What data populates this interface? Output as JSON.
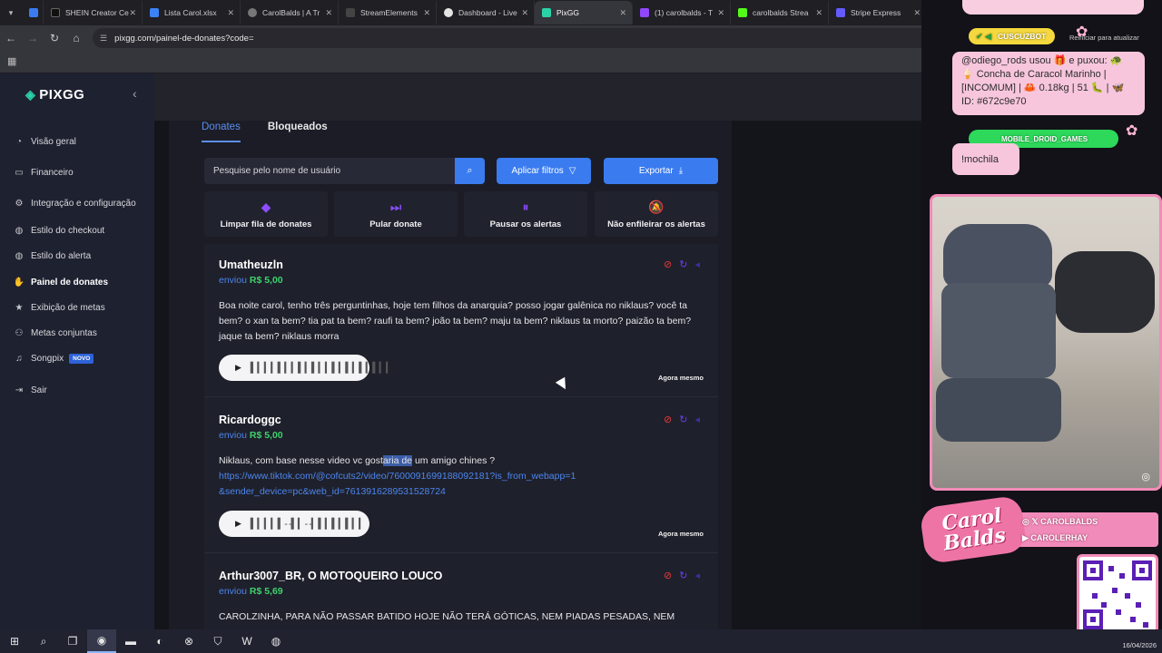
{
  "browser": {
    "tabs": [
      {
        "label": "SHEIN Creator Ce",
        "color": "#111111"
      },
      {
        "label": "Lista Carol.xlsx",
        "color": "#3b82f6"
      },
      {
        "label": "CarolBalds | A Tr",
        "color": "#555555"
      },
      {
        "label": "StreamElements",
        "color": "#222222"
      },
      {
        "label": "Dashboard - Live",
        "color": "#e5e5e5"
      },
      {
        "label": "PixGG",
        "color": "#2bd3a8"
      },
      {
        "label": "(1) carolbalds - T",
        "color": "#9146ff"
      },
      {
        "label": "carolbalds Strea",
        "color": "#53fc18"
      },
      {
        "label": "Stripe Express",
        "color": "#635bff"
      }
    ],
    "url": "pixgg.com/painel-de-donates?code=",
    "refresh_hint": "Reiniciar para atualizar"
  },
  "sidebar": {
    "logo": "PIXGG",
    "items": [
      {
        "label": "Visão geral",
        "icon": "speedometer-icon"
      },
      {
        "label": "Financeiro",
        "icon": "wallet-icon"
      },
      {
        "label": "Integração e configuração",
        "icon": "gear-icon"
      },
      {
        "label": "Estilo do checkout",
        "icon": "palette-icon"
      },
      {
        "label": "Estilo do alerta",
        "icon": "palette-icon"
      },
      {
        "label": "Painel de donates",
        "icon": "hand-heart-icon"
      },
      {
        "label": "Exibição de metas",
        "icon": "star-icon"
      },
      {
        "label": "Metas conjuntas",
        "icon": "users-icon"
      },
      {
        "label": "Songpix",
        "icon": "music-icon",
        "badge": "NOVO"
      },
      {
        "label": "Sair",
        "icon": "logout-icon"
      }
    ]
  },
  "main": {
    "tabs": [
      {
        "label": "Donates"
      },
      {
        "label": "Bloqueados"
      }
    ],
    "search_placeholder": "Pesquise pelo nome de usuário",
    "filter_label": "Aplicar filtros",
    "export_label": "Exportar",
    "actions": [
      {
        "label": "Limpar fila de donates",
        "icon": "eraser-icon"
      },
      {
        "label": "Pular donate",
        "icon": "skip-icon"
      },
      {
        "label": "Pausar os alertas",
        "icon": "pause-icon"
      },
      {
        "label": "Não enfileirar os alertas",
        "icon": "bell-off-icon"
      }
    ],
    "donations": [
      {
        "name": "Umatheuzln",
        "sent": "enviou",
        "amount": "R$ 5,00",
        "message": "Boa noite carol, tenho três perguntinhas, hoje tem filhos da anarquia? posso jogar galênica no niklaus? você ta bem? o xan ta bem? tia pat ta bem? raufi ta bem? joão ta bem? maju ta bem? niklaus ta morto? paizão ta bem? jaque ta bem? niklaus morra",
        "time": "Agora mesmo"
      },
      {
        "name": "Ricardoggc",
        "sent": "enviou",
        "amount": "R$ 5,00",
        "message_before": "Niklaus, com base nesse video vc gost",
        "message_highlight": "aria de",
        "message_after": " um amigo chines ?",
        "link": "https://www.tiktok.com/@cofcuts2/video/7600091699188092181?is_from_webapp=1&sender_device=pc&web_id=7613916289531528724",
        "time": "Agora mesmo"
      },
      {
        "name": "Arthur3007_BR, O MOTOQUEIRO LOUCO",
        "sent": "enviou",
        "amount": "R$ 5,69",
        "message": "CAROLZINHA, PARA NÃO PASSAR BATIDO HOJE NÃO TERÁ GÓTICAS, NEM PIADAS PESADAS, NEM"
      }
    ]
  },
  "overlay": {
    "chat1_user": "CUSCUZBOT",
    "chat1_text": "@odiego_rods usou 🎁 e puxou: 🐢 🍦 Concha de Caracol Marinho | [INCOMUM] | 🦀 0.18kg | 51 🐛 | 🦋 ID: #672c9e70",
    "chat2_user": "MOBILE_DROID_GAMES",
    "chat2_text": "!mochila",
    "banner_logo_line1": "Carol",
    "banner_logo_line2": "Balds",
    "social1": "CAROLBALDS",
    "social2": "CAROLERHAY"
  },
  "taskbar": {
    "date": "16/04/2026"
  }
}
